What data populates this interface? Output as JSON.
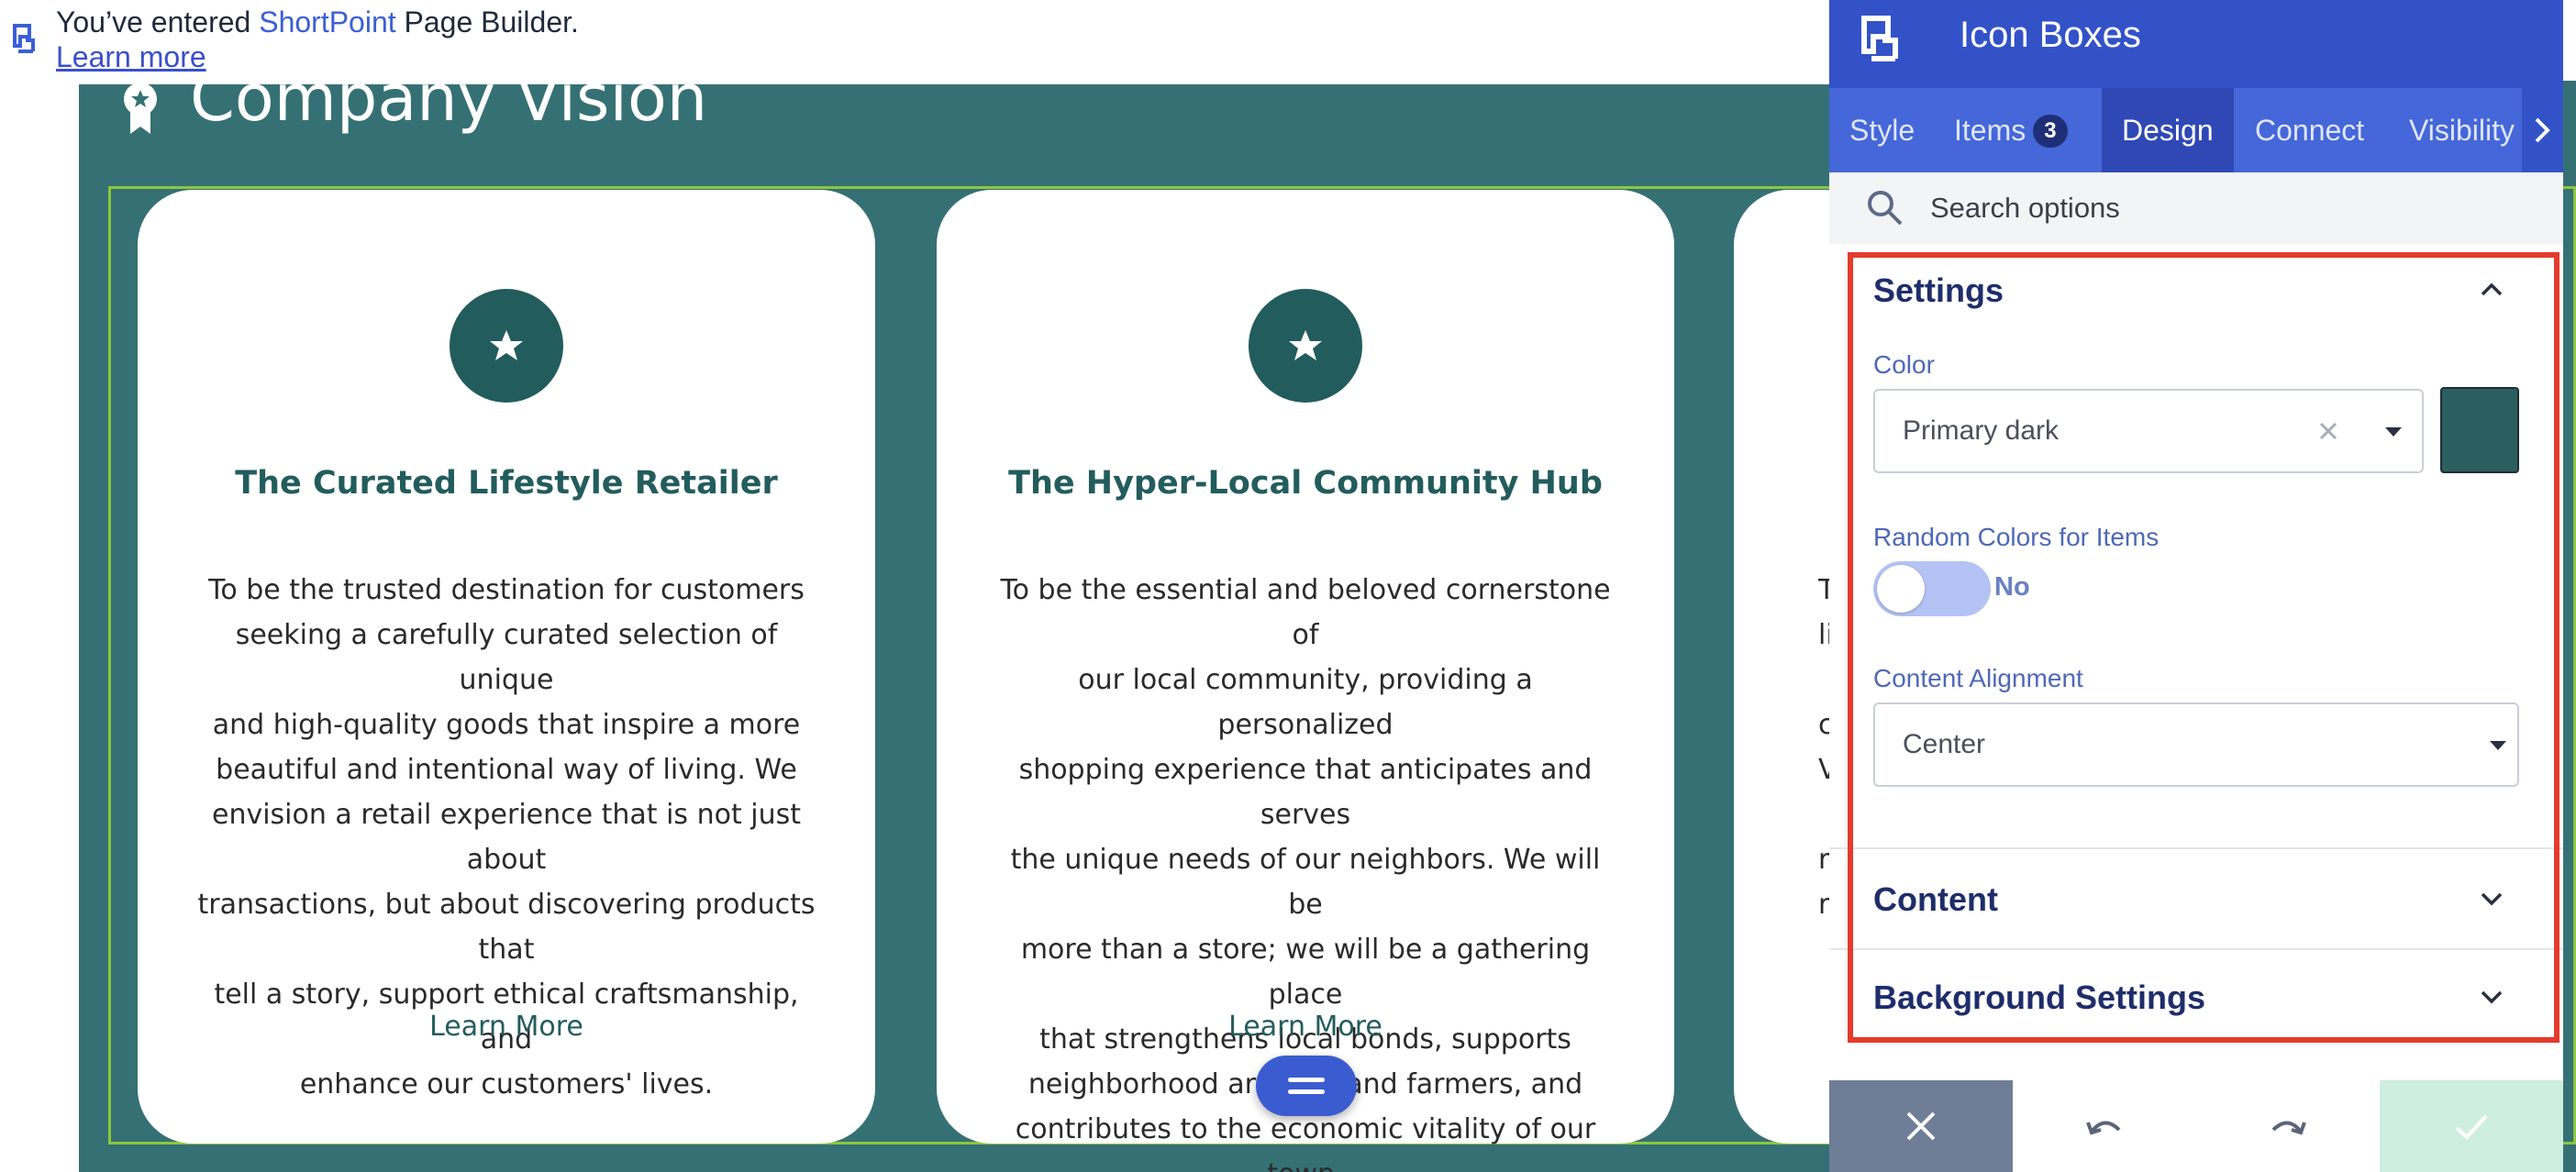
{
  "notice": {
    "text_before": "You’ve entered ",
    "brand": "ShortPoint",
    "text_after": " Page Builder.",
    "learn_more": "Learn more"
  },
  "page": {
    "section_title": "Company Vision",
    "cards": [
      {
        "title": "The Curated Lifestyle Retailer",
        "lines": [
          "To be the trusted destination for customers",
          "seeking a carefully curated selection of unique",
          "and high-quality goods that inspire a more",
          "beautiful and intentional way of living. We",
          "envision a retail experience that is not just about",
          "transactions, but about discovering products that",
          "tell a story, support ethical craftsmanship, and",
          "enhance our customers' lives."
        ],
        "link": "Learn More"
      },
      {
        "title": "The Hyper-Local Community Hub",
        "lines": [
          "To be the essential and beloved cornerstone of",
          "our local community, providing a personalized",
          "shopping experience that anticipates and serves",
          "the unique needs of our neighbors. We will be",
          "more than a store; we will be a gathering place",
          "that strengthens local bonds, supports",
          "neighborhood artisans and farmers, and",
          "contributes to the economic vitality of our town."
        ],
        "link": "Learn More"
      },
      {
        "lines": [
          "T",
          "li",
          "",
          "ch",
          "V",
          "",
          "re",
          "r"
        ]
      }
    ]
  },
  "panel": {
    "title": "Icon Boxes",
    "tabs": [
      {
        "label": "Style"
      },
      {
        "label": "Items",
        "count": "3"
      },
      {
        "label": "Design"
      },
      {
        "label": "Connect"
      },
      {
        "label": "Visibility"
      }
    ],
    "search_placeholder": "Search options",
    "settings": {
      "heading": "Settings",
      "color_label": "Color",
      "color_value": "Primary dark",
      "random_label": "Random Colors for Items",
      "random_value": "No",
      "alignment_label": "Content Alignment",
      "alignment_value": "Center"
    },
    "content_heading": "Content",
    "background_heading": "Background Settings"
  },
  "colors": {
    "section_bg": "#357174",
    "primary_dark": "#235c5c",
    "panel_header": "#3352c8",
    "highlight": "#e53b2c"
  }
}
